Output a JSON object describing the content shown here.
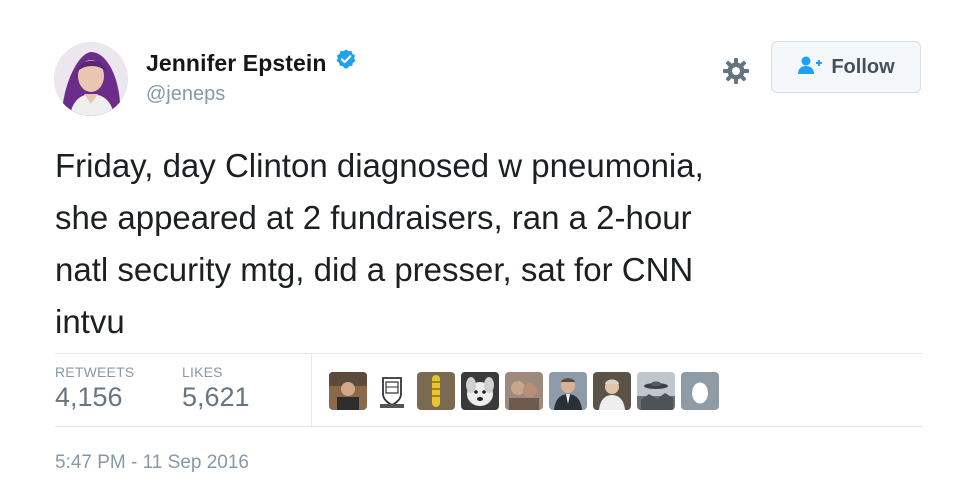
{
  "author": {
    "display_name": "Jennifer Epstein",
    "handle": "@jeneps",
    "verified": true,
    "avatar_icon": "profile-photo"
  },
  "actions": {
    "settings_icon": "gear-icon",
    "follow_label": "Follow",
    "follow_icon": "add-user-icon"
  },
  "tweet": {
    "text_lines": [
      "Friday, day Clinton diagnosed w pneumonia,",
      "she appeared at 2 fundraisers, ran a 2-hour",
      "natl security mtg, did a presser, sat for CNN",
      "intvu"
    ]
  },
  "stats": {
    "retweets_label": "RETWEETS",
    "retweets_value": "4,156",
    "likes_label": "LIKES",
    "likes_value": "5,621"
  },
  "likers": [
    {
      "icon": "liker-avatar-photo"
    },
    {
      "icon": "liker-avatar-crest"
    },
    {
      "icon": "liker-avatar-photo"
    },
    {
      "icon": "liker-avatar-dog"
    },
    {
      "icon": "liker-avatar-photo"
    },
    {
      "icon": "liker-avatar-photo"
    },
    {
      "icon": "liker-avatar-photo"
    },
    {
      "icon": "liker-avatar-photo"
    },
    {
      "icon": "default-egg-icon"
    }
  ],
  "timestamp": "5:47 PM - 11 Sep 2016",
  "colors": {
    "verified": "#1da1f2",
    "follow_icon": "#1da1f2",
    "muted_text": "#8899a6"
  }
}
